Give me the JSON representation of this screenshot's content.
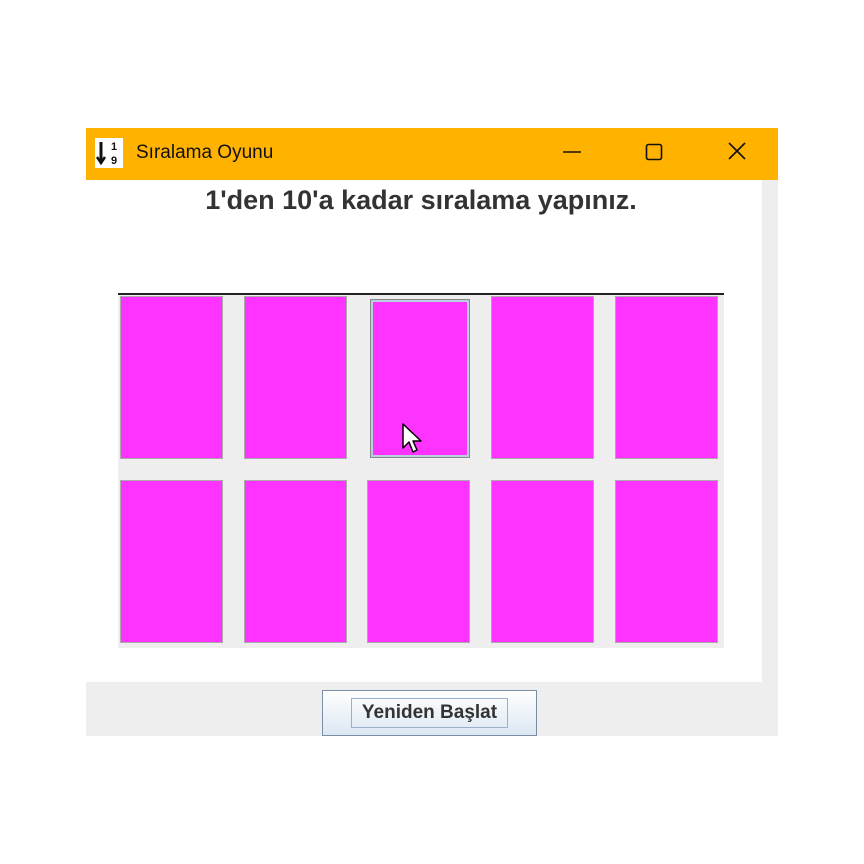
{
  "window": {
    "title": "Sıralama Oyunu",
    "icon": "sort-numeric-icon",
    "icon_glyphs": {
      "top": "1",
      "bottom": "9"
    },
    "title_bar_color": "#ffb300",
    "controls": [
      "minimize-icon",
      "maximize-icon",
      "close-icon"
    ]
  },
  "instruction": "1'den 10'a kadar sıralama yapınız.",
  "cards": {
    "color": "#ff33ff",
    "rows": 2,
    "columns": 5,
    "selected_index": 2
  },
  "restart_button": {
    "label": "Yeniden Başlat"
  }
}
